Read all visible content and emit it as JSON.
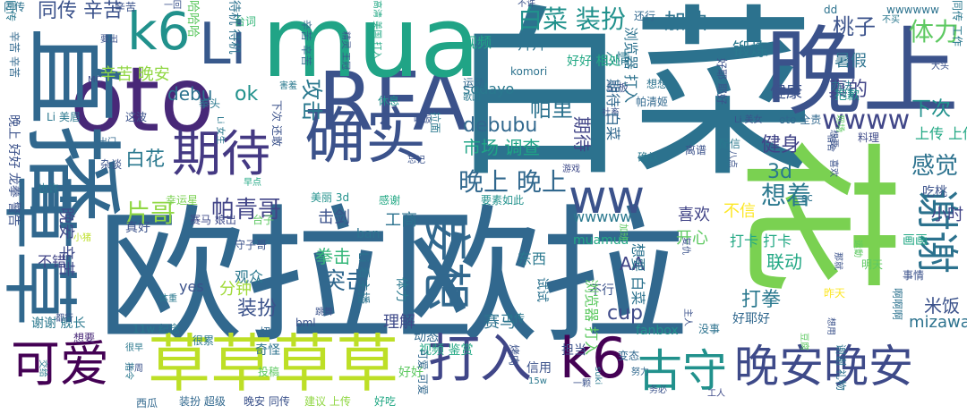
{
  "words": [
    {
      "text": "欧拉欧拉",
      "color": "#31688e"
    },
    {
      "text": "白菜",
      "color": "#2c728e"
    },
    {
      "text": "晚上",
      "color": "#3b528b"
    },
    {
      "text": "花",
      "color": "#7ad151"
    },
    {
      "text": "oto",
      "color": "#482878"
    },
    {
      "text": "RFA",
      "color": "#3b528b"
    },
    {
      "text": "mua",
      "color": "#20a486"
    },
    {
      "text": "直播",
      "color": "#31688e"
    },
    {
      "text": "草草",
      "color": "#31688e"
    },
    {
      "text": "确实",
      "color": "#3b528b"
    },
    {
      "text": "草草草草",
      "color": "#bddf26"
    },
    {
      "text": "k6",
      "color": "#21918c"
    },
    {
      "text": "Li",
      "color": "#38598c"
    },
    {
      "text": "可爱",
      "color": "#440154"
    },
    {
      "text": "打入",
      "color": "#404688"
    },
    {
      "text": "k6",
      "color": "#440154"
    },
    {
      "text": "古守",
      "color": "#21918c"
    },
    {
      "text": "晚安晚安",
      "color": "#3e4a89"
    },
    {
      "text": "谢谢",
      "color": "#2c728e"
    },
    {
      "text": "期待",
      "color": "#443983"
    },
    {
      "text": "妄想",
      "color": "#31688e"
    },
    {
      "text": "ww",
      "color": "#3b528b"
    },
    {
      "text": "白菜 装扮",
      "color": "#21918c"
    },
    {
      "text": "加油",
      "color": "#2c728e"
    },
    {
      "text": "体力",
      "color": "#5ec962"
    },
    {
      "text": "桃子",
      "color": "#3b528b"
    },
    {
      "text": "wwww",
      "color": "#404688"
    },
    {
      "text": "晚上 晚上",
      "color": "#31688e"
    },
    {
      "text": "片哥",
      "color": "#90d743"
    },
    {
      "text": "帕青哥",
      "color": "#414487"
    },
    {
      "text": "debubu",
      "color": "#31688e"
    },
    {
      "text": "想着",
      "color": "#2a788e"
    },
    {
      "text": "感觉",
      "color": "#2c728e"
    },
    {
      "text": "健身",
      "color": "#414487"
    },
    {
      "text": "同传 辛苦",
      "color": "#3b528b"
    },
    {
      "text": "ok",
      "color": "#21918c"
    },
    {
      "text": "攻击",
      "color": "#2a788e"
    },
    {
      "text": "帕里",
      "color": "#2c728e"
    },
    {
      "text": "真的",
      "color": "#414487"
    },
    {
      "text": "debu",
      "color": "#2c728e"
    },
    {
      "text": "3d",
      "color": "#2a788e"
    },
    {
      "text": "下次",
      "color": "#21918c"
    },
    {
      "text": "白花",
      "color": "#2a788e"
    },
    {
      "text": "突击",
      "color": "#31688e"
    },
    {
      "text": "装扮",
      "color": "#3b528b"
    },
    {
      "text": "拳击",
      "color": "#35b779"
    },
    {
      "text": "打拳",
      "color": "#2a788e"
    },
    {
      "text": "cup",
      "color": "#3e4a89"
    },
    {
      "text": "联动",
      "color": "#22a884"
    },
    {
      "text": "米饭",
      "color": "#3b528b"
    },
    {
      "text": "mizawa",
      "color": "#2c728e"
    },
    {
      "text": "市场 调查",
      "color": "#20a486"
    },
    {
      "text": "期待",
      "color": "#414487"
    },
    {
      "text": "辛苦 晚安",
      "color": "#90d743"
    },
    {
      "text": "锻炼",
      "color": "#2a788e"
    },
    {
      "text": "健康",
      "color": "#3b528b"
    },
    {
      "text": "暑假",
      "color": "#2c728e"
    },
    {
      "text": "喜欢",
      "color": "#414487"
    },
    {
      "text": "不信",
      "color": "#fde725"
    },
    {
      "text": "分钟",
      "color": "#a0da39"
    },
    {
      "text": "击剑",
      "color": "#3b528b"
    },
    {
      "text": "工商",
      "color": "#2c728e"
    },
    {
      "text": "开心",
      "color": "#5ec962"
    },
    {
      "text": "小时",
      "color": "#414487"
    },
    {
      "text": "wwwww",
      "color": "#2a788e"
    },
    {
      "text": "理解",
      "color": "#3e4a89"
    },
    {
      "text": "赛马",
      "color": "#2c728e"
    },
    {
      "text": "AA",
      "color": "#414487"
    },
    {
      "text": "打卡 打卡",
      "color": "#22a884"
    },
    {
      "text": "sodayo",
      "color": "#2a788e"
    },
    {
      "text": "心情",
      "color": "#2a788e"
    },
    {
      "text": "上传 上传",
      "color": "#22a884"
    },
    {
      "text": "视频",
      "color": "#20a486"
    },
    {
      "text": "运动",
      "color": "#31688e"
    },
    {
      "text": "拜拜",
      "color": "#2c728e"
    },
    {
      "text": "好好 相处",
      "color": "#22a884"
    },
    {
      "text": "台词",
      "color": "#35b779"
    },
    {
      "text": "muamua",
      "color": "#22a884"
    },
    {
      "text": "yes",
      "color": "#3b528b"
    },
    {
      "text": "观众",
      "color": "#2a788e"
    },
    {
      "text": "不错",
      "color": "#414487"
    },
    {
      "text": "晚安 辛苦",
      "color": "#3e4a89"
    },
    {
      "text": "谢谢 舰长",
      "color": "#2a788e"
    },
    {
      "text": "东西",
      "color": "#2a788e"
    },
    {
      "text": "fanbox",
      "color": "#21918c"
    },
    {
      "text": "好好",
      "color": "#5ec962"
    },
    {
      "text": "奇怪",
      "color": "#2c728e"
    },
    {
      "text": "信用",
      "color": "#3b528b"
    },
    {
      "text": "视频 鉴赏",
      "color": "#22a884"
    },
    {
      "text": "动态",
      "color": "#31688e"
    },
    {
      "text": "上传",
      "color": "#2a788e"
    },
    {
      "text": "好耶好",
      "color": "#31688e"
    },
    {
      "text": "想要",
      "color": "#482878"
    },
    {
      "text": "真好",
      "color": "#3b528b"
    },
    {
      "text": "赛马 娘出",
      "color": "#3e4a89"
    },
    {
      "text": "台子",
      "color": "#5ec962"
    },
    {
      "text": "守子哥",
      "color": "#3b528b"
    },
    {
      "text": "体力",
      "color": "#2a788e"
    },
    {
      "text": "ban",
      "color": "#2c728e"
    },
    {
      "text": "不行",
      "color": "#3b528b"
    },
    {
      "text": "变态",
      "color": "#31688e"
    },
    {
      "text": "担当",
      "color": "#3b528b"
    },
    {
      "text": "帕清姬",
      "color": "#31688e"
    },
    {
      "text": "确认",
      "color": "#2a788e"
    },
    {
      "text": "配信",
      "color": "#2a788e"
    },
    {
      "text": "离谱",
      "color": "#3b528b"
    },
    {
      "text": "想想",
      "color": "#2c728e"
    },
    {
      "text": "砧板",
      "color": "#3b528b"
    },
    {
      "text": "办法",
      "color": "#2a788e"
    },
    {
      "text": "抱歉",
      "color": "#21918c"
    },
    {
      "text": "料理",
      "color": "#3e4a89"
    },
    {
      "text": "吃桃",
      "color": "#3b528b"
    },
    {
      "text": "画画",
      "color": "#22a884"
    },
    {
      "text": "明天",
      "color": "#5ec962"
    },
    {
      "text": "事情",
      "color": "#3b528b"
    },
    {
      "text": "昨天",
      "color": "#fde725"
    },
    {
      "text": "幸运星",
      "color": "#7ad151"
    },
    {
      "text": "美丽 3d",
      "color": "#21918c"
    },
    {
      "text": "感谢",
      "color": "#22a884"
    },
    {
      "text": "杂谈",
      "color": "#3b528b"
    },
    {
      "text": "出门",
      "color": "#31688e"
    },
    {
      "text": "这波",
      "color": "#3b528b"
    },
    {
      "text": "拳头",
      "color": "#2a788e"
    },
    {
      "text": "休息",
      "color": "#21918c"
    },
    {
      "text": "吃饭",
      "color": "#3b528b"
    },
    {
      "text": "社畜",
      "color": "#3b528b"
    },
    {
      "text": "komori",
      "color": "#2c728e"
    },
    {
      "text": "歌回",
      "color": "#2a788e"
    },
    {
      "text": "游戏",
      "color": "#3e4a89"
    },
    {
      "text": "忘记",
      "color": "#3b528b"
    },
    {
      "text": "还行",
      "color": "#31688e"
    },
    {
      "text": "不买",
      "color": "#2a788e"
    },
    {
      "text": "wwwwww",
      "color": "#2c728e"
    },
    {
      "text": "大头",
      "color": "#3b528b"
    },
    {
      "text": "dd",
      "color": "#2c728e"
    },
    {
      "text": "一回",
      "color": "#3b528b"
    },
    {
      "text": "不许",
      "color": "#3b528b"
    },
    {
      "text": "MC",
      "color": "#3e4a89"
    },
    {
      "text": "要出",
      "color": "#3b528b"
    },
    {
      "text": "害羞",
      "color": "#2a788e"
    },
    {
      "text": "Li 美眉",
      "color": "#2a788e"
    },
    {
      "text": "Li 美女",
      "color": "#3b528b"
    },
    {
      "text": "oto 全责",
      "color": "#31688e"
    },
    {
      "text": "sc",
      "color": "#2c728e"
    },
    {
      "text": "同传",
      "color": "#2c728e"
    },
    {
      "text": "11w 纪念",
      "color": "#2a788e"
    },
    {
      "text": "很累",
      "color": "#2a788e"
    },
    {
      "text": "切片",
      "color": "#31688e"
    },
    {
      "text": "跳舞",
      "color": "#3b528b"
    },
    {
      "text": "bml",
      "color": "#3b528b"
    },
    {
      "text": "下周",
      "color": "#3b528b"
    },
    {
      "text": "投稿",
      "color": "#5ec962"
    },
    {
      "text": "晚安 同传",
      "color": "#3b528b"
    },
    {
      "text": "建议 上传",
      "color": "#90d743"
    },
    {
      "text": "好吃",
      "color": "#22a884"
    },
    {
      "text": "15w",
      "color": "#2a788e"
    },
    {
      "text": "一颗",
      "color": "#3b528b"
    },
    {
      "text": "务必",
      "color": "#3b528b"
    },
    {
      "text": "工人",
      "color": "#3e4a89"
    },
    {
      "text": "努力",
      "color": "#31688e"
    },
    {
      "text": "没事",
      "color": "#2c728e"
    },
    {
      "text": "装扮 超级",
      "color": "#31688e"
    },
    {
      "text": "西瓜",
      "color": "#31688e"
    },
    {
      "text": "都行",
      "color": "#3b528b"
    },
    {
      "text": "体重",
      "color": "#2a788e"
    },
    {
      "text": "很早",
      "color": "#2a788e"
    },
    {
      "text": "小猪",
      "color": "#bddf26"
    },
    {
      "text": "也许",
      "color": "#2a788e"
    },
    {
      "text": "早点",
      "color": "#22a884"
    },
    {
      "text": "要素如此",
      "color": "#21918c"
    },
    {
      "text": "辛苦",
      "color": "#3b528b"
    },
    {
      "text": "同传",
      "color": "#2a788e"
    },
    {
      "text": "哈哈哈",
      "color": "#5ec962"
    },
    {
      "text": "待机 待机",
      "color": "#2c728e"
    },
    {
      "text": "辛苦 辛苦",
      "color": "#31688e"
    },
    {
      "text": "晚上 好好 龙拳 警告",
      "color": "#3b528b"
    },
    {
      "text": "辛苦 辛苦",
      "color": "#31688e"
    },
    {
      "text": "高清 美国 打入",
      "color": "#22a884"
    },
    {
      "text": "精灵 王冠",
      "color": "#3b528b"
    },
    {
      "text": "下次 还敢",
      "color": "#3b528b"
    },
    {
      "text": "Li 女生",
      "color": "#2a788e"
    },
    {
      "text": "浏览器 打入",
      "color": "#2c728e"
    },
    {
      "text": "期待 白菜",
      "color": "#31688e"
    },
    {
      "text": "好耶 耶好",
      "color": "#3b528b"
    },
    {
      "text": "八点",
      "color": "#3b528b"
    },
    {
      "text": "想要",
      "color": "#3b528b"
    },
    {
      "text": "谢谢 礼物",
      "color": "#2c728e"
    },
    {
      "text": "啊啊啊",
      "color": "#2c728e"
    },
    {
      "text": "浏览器 打入",
      "color": "#5ec962"
    },
    {
      "text": "想要 白菜",
      "color": "#2c728e"
    },
    {
      "text": "Li 看主播",
      "color": "#2c728e"
    },
    {
      "text": "试试",
      "color": "#2c728e"
    },
    {
      "text": "加班",
      "color": "#5ec962"
    },
    {
      "text": "主人",
      "color": "#3b528b"
    },
    {
      "text": "豆腐",
      "color": "#5ec962"
    },
    {
      "text": "想用",
      "color": "#3b528b"
    },
    {
      "text": "宿舍",
      "color": "#3b528b"
    },
    {
      "text": "可爱 可爱",
      "color": "#31688e"
    },
    {
      "text": "拉面",
      "color": "#2a788e"
    },
    {
      "text": "烤肉",
      "color": "#3b528b"
    },
    {
      "text": "suki",
      "color": "#2a788e"
    },
    {
      "text": "交给",
      "color": "#2a788e"
    },
    {
      "text": "指令",
      "color": "#2a788e"
    },
    {
      "text": "运動",
      "color": "#5ec962"
    },
    {
      "text": "复仇",
      "color": "#3b528b"
    },
    {
      "text": "喜欢",
      "color": "#3b528b"
    },
    {
      "text": "现场",
      "color": "#5ec962"
    },
    {
      "text": "那就",
      "color": "#3b528b"
    },
    {
      "text": "同传",
      "color": "#2a788e"
    },
    {
      "text": "工作",
      "color": "#2a788e"
    }
  ]
}
